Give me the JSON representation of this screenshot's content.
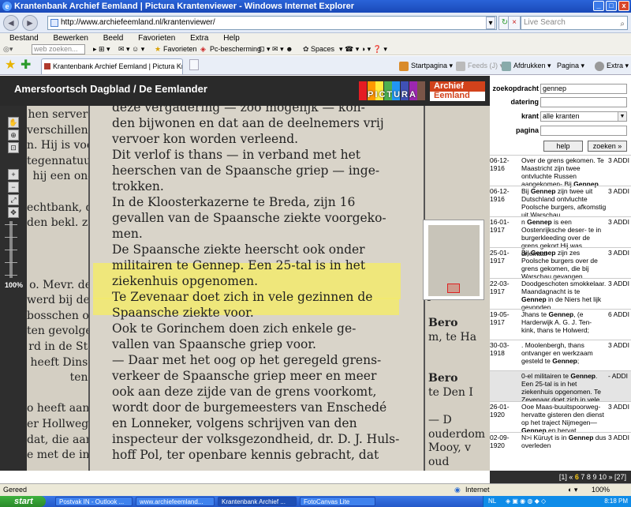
{
  "window": {
    "title": "Krantenbank Archief Eemland | Pictura Krantenviewer - Windows Internet Explorer"
  },
  "address": {
    "url": "http://www.archiefeemland.nl/krantenviewer/",
    "live_search": "Live Search"
  },
  "menu": [
    "Bestand",
    "Bewerken",
    "Beeld",
    "Favorieten",
    "Extra",
    "Help"
  ],
  "links_bar": {
    "search_placeholder": "web zoeken...",
    "favorites": "Favorieten",
    "protection": "Pc-bescherming",
    "spaces": "Spaces"
  },
  "tab": {
    "label": "Krantenbank Archief Eemland | Pictura Krantenviewer"
  },
  "toolbar": {
    "home": "Startpagina",
    "feeds": "Feeds (J)",
    "print": "Afdrukken",
    "page": "Pagina",
    "extra": "Extra"
  },
  "header": {
    "title": "Amersfoortsch Dagblad / De Eemlander",
    "logo_pictura": "PICTURA",
    "logo_archief": "Archief",
    "logo_eemland": "Eemland",
    "pictura_colors": [
      "#e51c23",
      "#ff9800",
      "#ffeb3b",
      "#4caf50",
      "#2196f3",
      "#3f51b5",
      "#9c27b0",
      "#795548"
    ]
  },
  "viewer": {
    "zoom": "100%",
    "tool_icons": [
      "hand-icon",
      "zoom-in-icon",
      "zoom-region-icon",
      "zoom-in-small-icon",
      "zoom-out-icon",
      "fit-icon",
      "move-icon"
    ],
    "article_lines": [
      "deze vergadering — zoo mogelijk — kon-",
      "den bijwonen en dat aan de deelnemers vrij",
      "vervoer kon worden verleend.",
      "Dit verlof is thans — in verband met het",
      "heerschen van de Spaansche griep — inge-",
      "trokken.",
      "In de Kloosterkazerne te Breda, zijn 16",
      "gevallen van de Spaansche ziekte voorgeko-",
      "men.",
      "De Spaansche ziekte heerscht ook onder",
      "militairen te Gennep. Een 25-tal is in het",
      "ziekenhuis opgenomen.",
      "Te Zevenaar doet zich in vele gezinnen de",
      "Spaansche ziekte voor.",
      "Ook te Gorinchem doen zich enkele ge-",
      "vallen van Spaansche griep voor.",
      "— Daar met het oog op het geregeld grens-",
      "verkeer de Spaansche griep meer en meer",
      "ook aan deze zijde van de grens voorkomt,",
      "wordt door de burgemeesters van Enschedé",
      "en Lonneker, volgens schrijven van den",
      "inspecteur der volksgezondheid, dr. D. J. Huls-",
      "hoff Pol, ter openbare kennis gebracht, dat"
    ],
    "left_column": [
      "hen server-",
      "verschillen-",
      "n. Hij is voor",
      "tegennatuur-",
      "hij een on-",
      "",
      "echtbank, de",
      "den bekl. zal",
      "",
      "",
      "",
      "o. Mevr. de",
      "werd bij den",
      "bosschen op",
      "ten gevolge",
      "rd in de St-",
      "heeft Dins-",
      "ten.",
      "",
      "o heeft aan-",
      "er Hollweg,",
      "dat, die aan",
      "e met de in-"
    ],
    "right_column": [
      "",
      "",
      "",
      "",
      "",
      "",
      "",
      "",
      "Bero",
      "sluis, car",
      "Bloemho",
      "W. A. Z",
      "Aang",
      "J. Brümn",
      "",
      "Bero",
      "m, te Ha",
      "",
      "",
      "Bero",
      "te Den I",
      "",
      "— D",
      "ouderdom",
      "Mooy, v",
      "oud"
    ]
  },
  "pager": {
    "prefix": "[1] «",
    "pages": [
      "6",
      "7",
      "8",
      "9",
      "10"
    ],
    "current": "6",
    "suffix": "» [27]"
  },
  "search_form": {
    "zoekopdracht_label": "zoekopdracht",
    "zoekopdracht_value": "gennep",
    "datering_label": "datering",
    "datering_value": "",
    "krant_label": "krant",
    "krant_value": "alle kranten",
    "pagina_label": "pagina",
    "pagina_value": "",
    "help_label": "help",
    "search_label": "zoeken »"
  },
  "results": [
    {
      "date": "06-12-\n1916",
      "text": "Over de grens gekomen. Te Maastricht zijn twee ontvluchte Russen aangekomen- Bij Gennep",
      "add": "3 ADDI"
    },
    {
      "date": "06-12-\n1916",
      "text": "Bij Gennep zijn twee uit Dutschland ontvluchte Poolsche burgers, afkomstig uit Warschau",
      "add": "3 ADDI"
    },
    {
      "date": "16-01-\n1917",
      "text": "n Gennep is een Oostenrijksche deser- te in burgerkleeding over de grens gekort Hij was driemaal",
      "add": "3 ADDI"
    },
    {
      "date": "25-01-\n1917",
      "text": "Bij Gennep zijn zes Poolsche burgers over de grens gekomen, die bij Warschau gevangen",
      "add": "3 ADDI"
    },
    {
      "date": "22-03-\n1917",
      "text": "Doodgeschoten smokkelaar. Maandagnacht is te Gennep in de Niers het lijk gevonden",
      "add": "3 ADDI"
    },
    {
      "date": "19-05-\n1917",
      "text": "Jhans te Gennep, (e Harderwijk A. G. J. Ten- kink, thans te Holwerd;",
      "add": "6 ADDI"
    },
    {
      "date": "30-03-\n1918",
      "text": ". Moolenbergh, thans ontvanger en werkzaam gesteld te Gennep;",
      "add": "3 ADDI"
    },
    {
      "date": "",
      "text": "0-el militairen te Gennep. Een 25-tal is in het ziekenhuis opgenomen. Te Zevenaar doet zich in vele",
      "add": "- ADDI"
    },
    {
      "date": "26-01-\n1920",
      "text": "Ooe Maas-buuitspoorweg- hervatte gisteren den dienst op het traject Nijmegen— Gennep en hervat",
      "add": "3 ADDI"
    },
    {
      "date": "02-09-\n1920",
      "text": "N>i Küruyt is in Gennep dus overleden",
      "add": "3 ADDI"
    }
  ],
  "status": {
    "left": "Gereed",
    "zone": "Internet",
    "zoom": "100%"
  },
  "taskbar": {
    "start": "start",
    "items": [
      "Postvak IN - Outlook ...",
      "www.archiefeemland...",
      "Krantenbank Archief ...",
      "FotoCanvas Lite"
    ],
    "lang": "NL",
    "clock": "8:18 PM"
  }
}
